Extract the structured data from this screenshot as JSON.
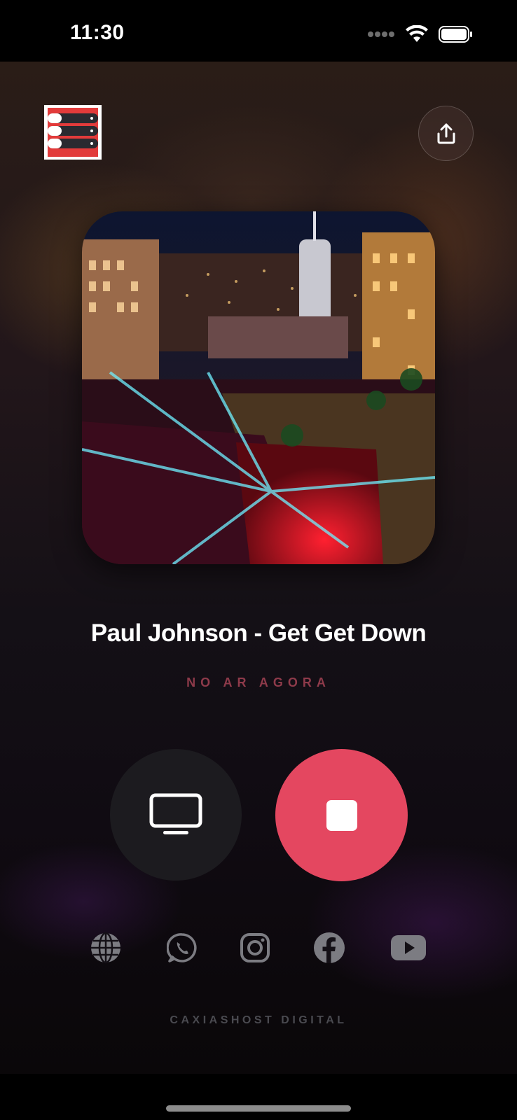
{
  "status_bar": {
    "time": "11:30",
    "icons": [
      "signal-dots-icon",
      "wifi-icon",
      "battery-icon"
    ]
  },
  "header": {
    "logo_icon": "server-stack-logo",
    "share_icon": "share-upload-icon"
  },
  "player": {
    "artwork": "concert-cityscape-artwork",
    "track_title": "Paul Johnson - Get Get Down",
    "status_label": "NO AR AGORA",
    "tv_icon": "tv-monitor-icon",
    "stop_icon": "stop-icon"
  },
  "social_links": [
    {
      "name": "globe-icon"
    },
    {
      "name": "whatsapp-icon"
    },
    {
      "name": "instagram-icon"
    },
    {
      "name": "facebook-icon"
    },
    {
      "name": "youtube-icon"
    }
  ],
  "footer": {
    "text": "CAXIASHOST DIGITAL"
  },
  "colors": {
    "accent": "#e44760",
    "status_label": "#8e3a4a",
    "secondary_button": "#1c1b1f"
  }
}
